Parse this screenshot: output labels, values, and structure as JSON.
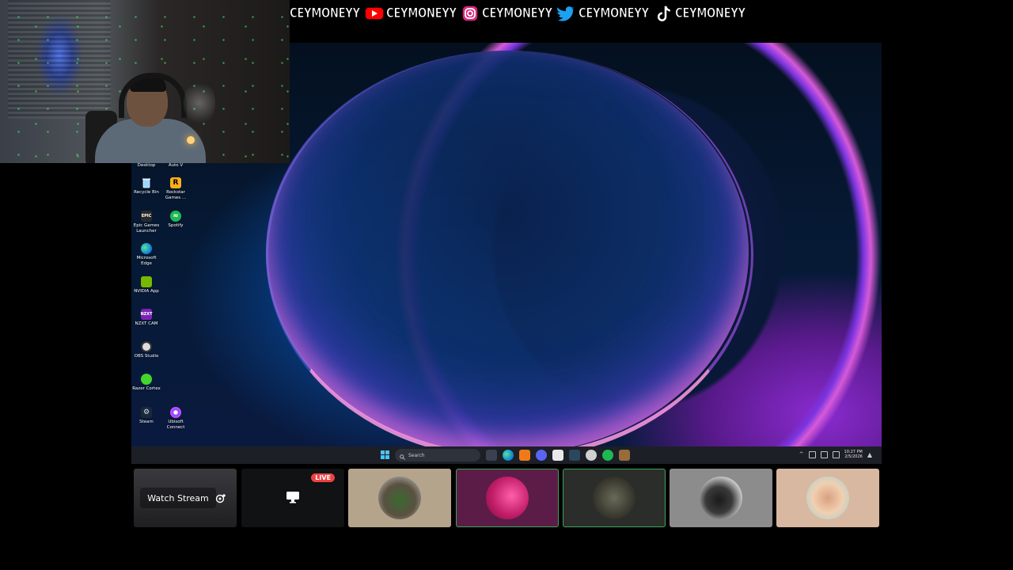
{
  "social": {
    "handles": [
      {
        "platform": "none",
        "text": "CEYMONEYY"
      },
      {
        "platform": "youtube",
        "text": "CEYMONEYY"
      },
      {
        "platform": "instagram",
        "text": "CEYMONEYY"
      },
      {
        "platform": "twitter",
        "text": "CEYMONEYY"
      },
      {
        "platform": "tiktok",
        "text": "CEYMONEYY"
      }
    ]
  },
  "desktop": {
    "icons": [
      {
        "label": "Desktop",
        "icon": "folder-icon"
      },
      {
        "label": "Auto V",
        "icon": "app-icon"
      },
      {
        "label": "Recycle Bin",
        "icon": "recycle-bin-icon"
      },
      {
        "label": "Rockstar Games ...",
        "icon": "rockstar-icon"
      },
      {
        "label": "Epic Games Launcher",
        "icon": "epic-games-icon"
      },
      {
        "label": "Spotify",
        "icon": "spotify-icon"
      },
      {
        "label": "Microsoft Edge",
        "icon": "edge-icon"
      },
      {
        "label": "NVIDIA App",
        "icon": "nvidia-icon"
      },
      {
        "label": "NZXT CAM",
        "icon": "nzxt-icon"
      },
      {
        "label": "OBS Studio",
        "icon": "obs-icon"
      },
      {
        "label": "Razer Cortex",
        "icon": "razer-icon"
      },
      {
        "label": "Steam",
        "icon": "steam-icon"
      },
      {
        "label": "Ubisoft Connect",
        "icon": "ubisoft-icon"
      }
    ]
  },
  "taskbar": {
    "search_placeholder": "Search",
    "time": "10:27 PM",
    "date": "2/5/2026"
  },
  "participants": {
    "watch_label": "Watch Stream",
    "live_label": "LIVE"
  },
  "colors": {
    "live": "#ed4245",
    "speaking_border": "#3ba55d",
    "windows_accent": "#4cc2ff"
  }
}
